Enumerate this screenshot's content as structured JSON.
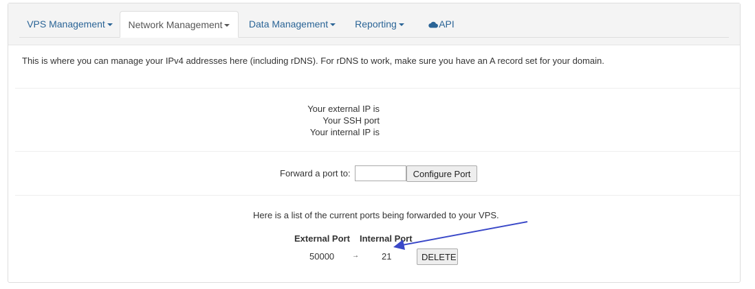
{
  "tabs": [
    {
      "label": "VPS Management",
      "has_caret": true
    },
    {
      "label": "Network Management",
      "has_caret": true,
      "active": true
    },
    {
      "label": "Data Management",
      "has_caret": true
    },
    {
      "label": "Reporting",
      "has_caret": true
    },
    {
      "label": "API",
      "icon": "cloud-icon"
    }
  ],
  "description": "This is where you can manage your IPv4 addresses here (including rDNS). For rDNS to work, make sure you have an A record set for your domain.",
  "info": {
    "external_ip": "Your external IP is",
    "ssh_port": "Your SSH port",
    "internal_ip": "Your internal IP is"
  },
  "forward": {
    "label": "Forward a port to:",
    "input_value": "",
    "button": "Configure Port"
  },
  "ports": {
    "description": "Here is a list of the current ports being forwarded to your VPS.",
    "headers": [
      "External Port",
      "Internal Port"
    ],
    "rows": [
      {
        "external": "50000",
        "arrow": "→",
        "internal": "21",
        "action": "DELETE"
      }
    ]
  },
  "colors": {
    "link": "#2a6496",
    "annotation_arrow": "#3a48c8"
  }
}
